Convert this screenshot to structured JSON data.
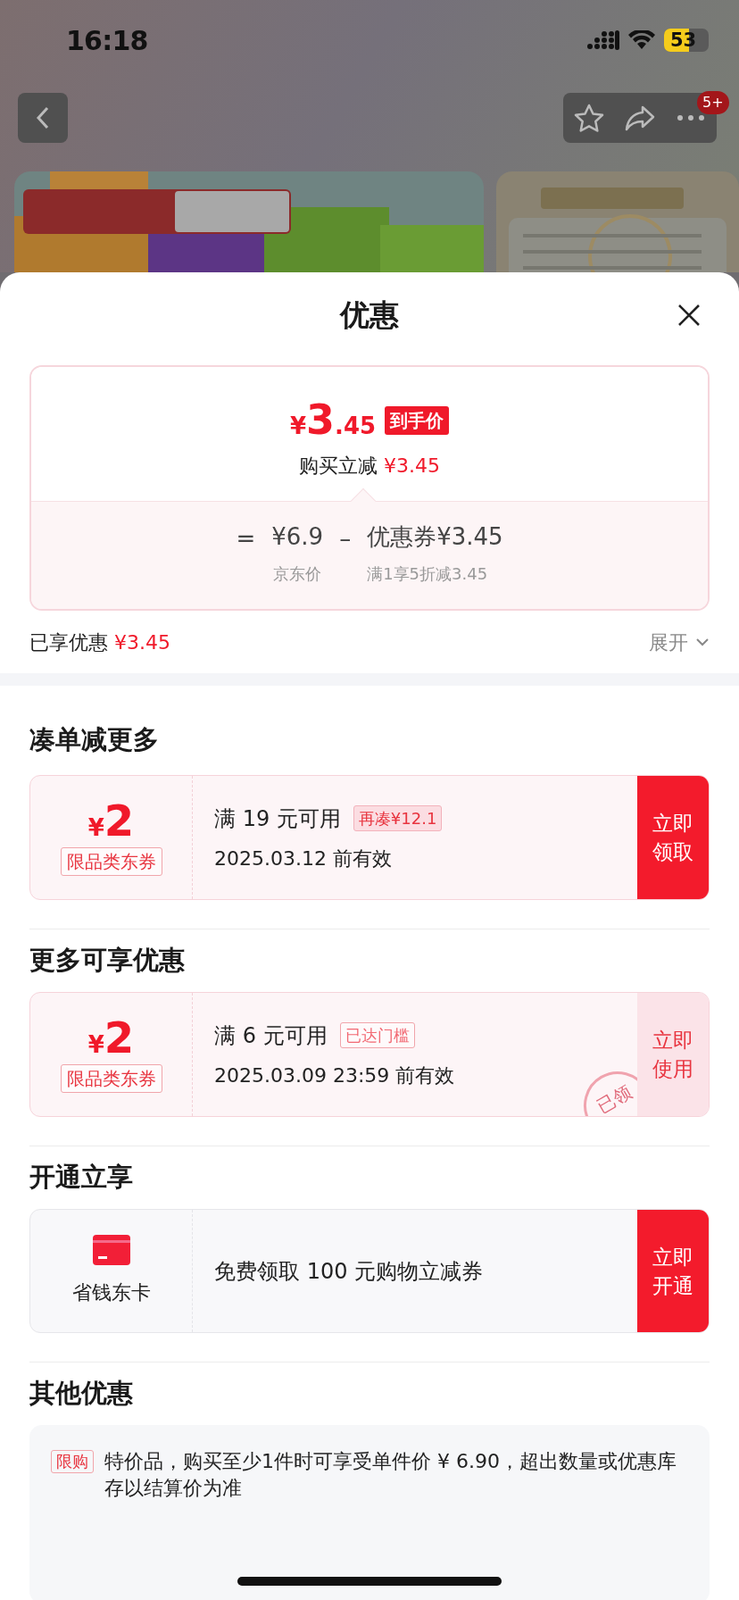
{
  "status_bar": {
    "time": "16:18",
    "battery": "53"
  },
  "nav": {
    "badge": "5+"
  },
  "sheet": {
    "title": "优惠"
  },
  "price_card": {
    "currency": "¥",
    "price_int": "3",
    "price_dec": ".45",
    "price_tag": "到手价",
    "saving_label": "购买立减",
    "saving_value": "¥3.45",
    "equals": "=",
    "base_price": "¥6.9",
    "minus": "–",
    "coupon_label": "优惠券",
    "coupon_value": "¥3.45",
    "base_caption": "京东价",
    "coupon_caption": "满1享5折减3.45"
  },
  "enjoyed": {
    "label": "已享优惠",
    "value": "¥3.45",
    "expand": "展开"
  },
  "sections": [
    {
      "title": "凑单减更多",
      "kind": "coupon",
      "coupon": {
        "currency": "¥",
        "amount": "2",
        "type": "限品类东券",
        "condition": "满 19 元可用",
        "tag": "再凑¥12.1",
        "validity": "2025.03.12 前有效",
        "action": "立即领取",
        "claimed": false
      }
    },
    {
      "title": "更多可享优惠",
      "kind": "coupon",
      "coupon": {
        "currency": "¥",
        "amount": "2",
        "type": "限品类东券",
        "condition": "满 6 元可用",
        "tag": "已达门槛",
        "validity": "2025.03.09 23:59 前有效",
        "action": "立即使用",
        "claimed": true,
        "stamp": "已领"
      }
    },
    {
      "title": "开通立享",
      "kind": "membership",
      "card": {
        "name": "省钱东卡",
        "offer": "免费领取 100 元购物立减券",
        "action": "立即开通"
      }
    },
    {
      "title": "其他优惠",
      "kind": "list",
      "items": [
        {
          "tag": "限购",
          "text": "特价品，购买至少1件时可享受单件价 ¥ 6.90，超出数量或优惠库存以结算价为准"
        }
      ]
    }
  ]
}
